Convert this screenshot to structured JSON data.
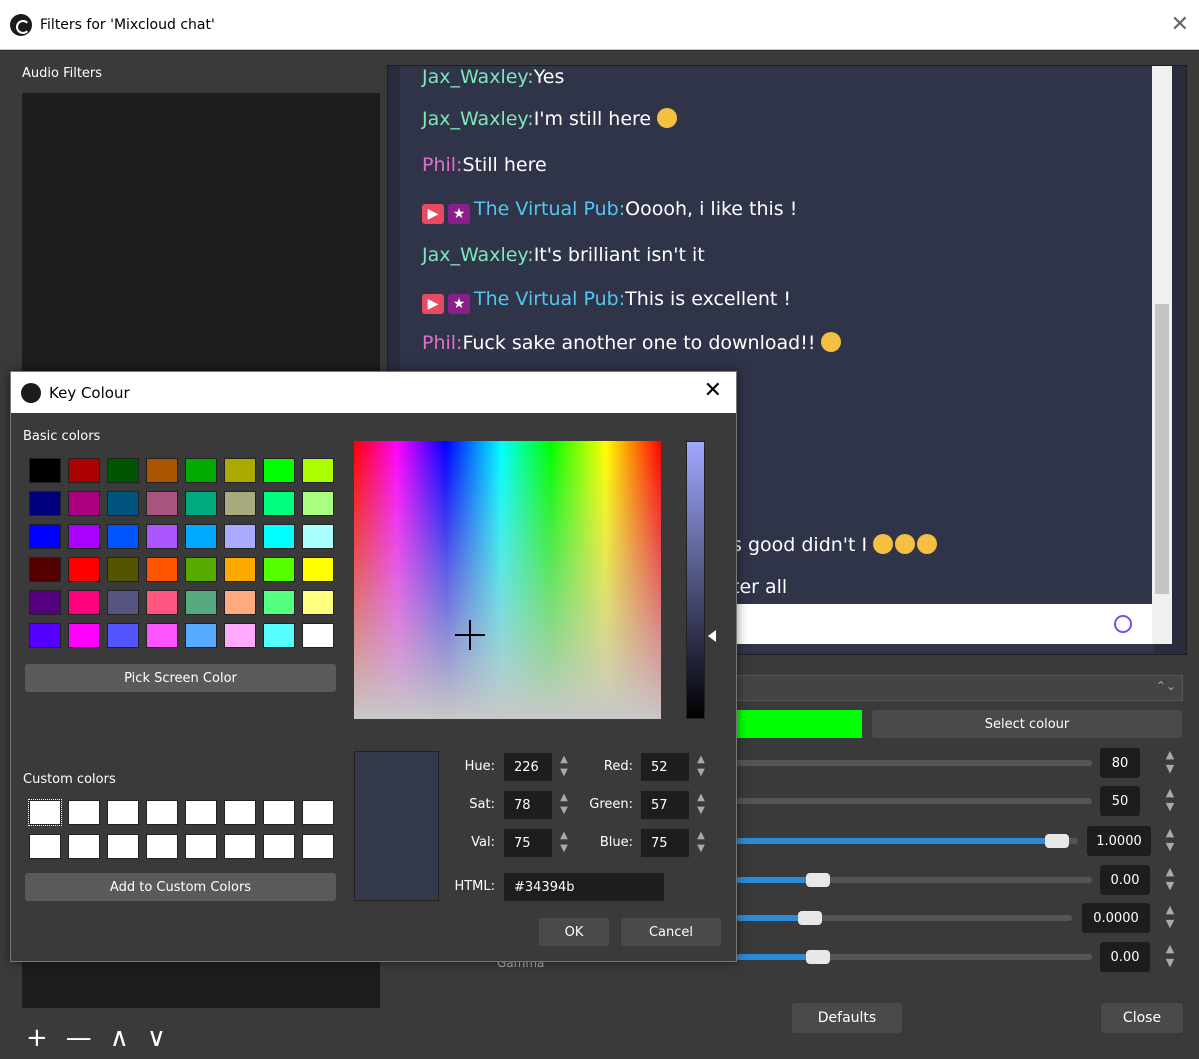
{
  "window": {
    "title": "Filters for 'Mixcloud chat'",
    "close": "✕"
  },
  "left": {
    "audio_filters_label": "Audio Filters",
    "add": "+",
    "remove": "—",
    "up": "∧",
    "down": "∨"
  },
  "chat": [
    {
      "name": "Jax_Waxley:",
      "msg": "Yes",
      "color": "green"
    },
    {
      "name": "Jax_Waxley:",
      "msg": "I'm still here",
      "color": "green",
      "emoji": 1
    },
    {
      "name": "Phil:",
      "msg": "Still here",
      "color": "pink"
    },
    {
      "name": "The Virtual Pub:",
      "msg": "Ooooh, i like this !",
      "color": "blue",
      "badges": true
    },
    {
      "name": "Jax_Waxley:",
      "msg": "It's brilliant isn't it",
      "color": "green"
    },
    {
      "name": "The Virtual Pub:",
      "msg": "This is excellent !",
      "color": "blue",
      "badges": true
    },
    {
      "name": "Phil:",
      "msg": "Fuck sake another one to download!!",
      "color": "pink",
      "emoji": 1
    }
  ],
  "chat_partial": {
    "line_a": "s good didn't I",
    "line_b": "ter all"
  },
  "controls": {
    "select_colour_label": "Select colour",
    "similarity": "80",
    "smoothness": "50",
    "opacity": "1.0000",
    "contrast": "0.00",
    "brightness": "0.0000",
    "gamma": "0.00",
    "gamma_label": "Gamma",
    "opacity_fill": 0.94,
    "contrast_fill": 0.23,
    "brightness_fill": 0.22,
    "gamma_fill": 0.23
  },
  "footer": {
    "defaults": "Defaults",
    "close": "Close"
  },
  "dialog": {
    "title": "Key Colour",
    "close": "✕",
    "basic_label": "Basic colors",
    "custom_label": "Custom colors",
    "pick_btn": "Pick Screen Color",
    "add_custom_btn": "Add to Custom Colors",
    "hue_label": "Hue:",
    "hue": "226",
    "sat_label": "Sat:",
    "sat": "78",
    "val_label": "Val:",
    "val": "75",
    "red_label": "Red:",
    "red": "52",
    "green_label": "Green:",
    "green": "57",
    "blue_label": "Blue:",
    "blue": "75",
    "html_label": "HTML:",
    "html": "#34394b",
    "ok": "OK",
    "cancel": "Cancel",
    "basic_colors": [
      "#000000",
      "#aa0000",
      "#005500",
      "#aa5500",
      "#00aa00",
      "#aaaa00",
      "#00ff00",
      "#aaff00",
      "#00007f",
      "#aa007f",
      "#00557f",
      "#aa557f",
      "#00aa7f",
      "#aaaa7f",
      "#00ff7f",
      "#aaff7f",
      "#0000ff",
      "#aa00ff",
      "#0055ff",
      "#aa55ff",
      "#00aaff",
      "#aaaaff",
      "#00ffff",
      "#aaffff",
      "#550000",
      "#ff0000",
      "#555500",
      "#ff5500",
      "#55aa00",
      "#ffaa00",
      "#55ff00",
      "#ffff00",
      "#55007f",
      "#ff007f",
      "#55557f",
      "#ff557f",
      "#55aa7f",
      "#ffaa7f",
      "#55ff7f",
      "#ffff7f",
      "#5500ff",
      "#ff00ff",
      "#5555ff",
      "#ff55ff",
      "#55aaff",
      "#ffaaff",
      "#55ffff",
      "#ffffff"
    ],
    "current_color": "#34394b"
  }
}
